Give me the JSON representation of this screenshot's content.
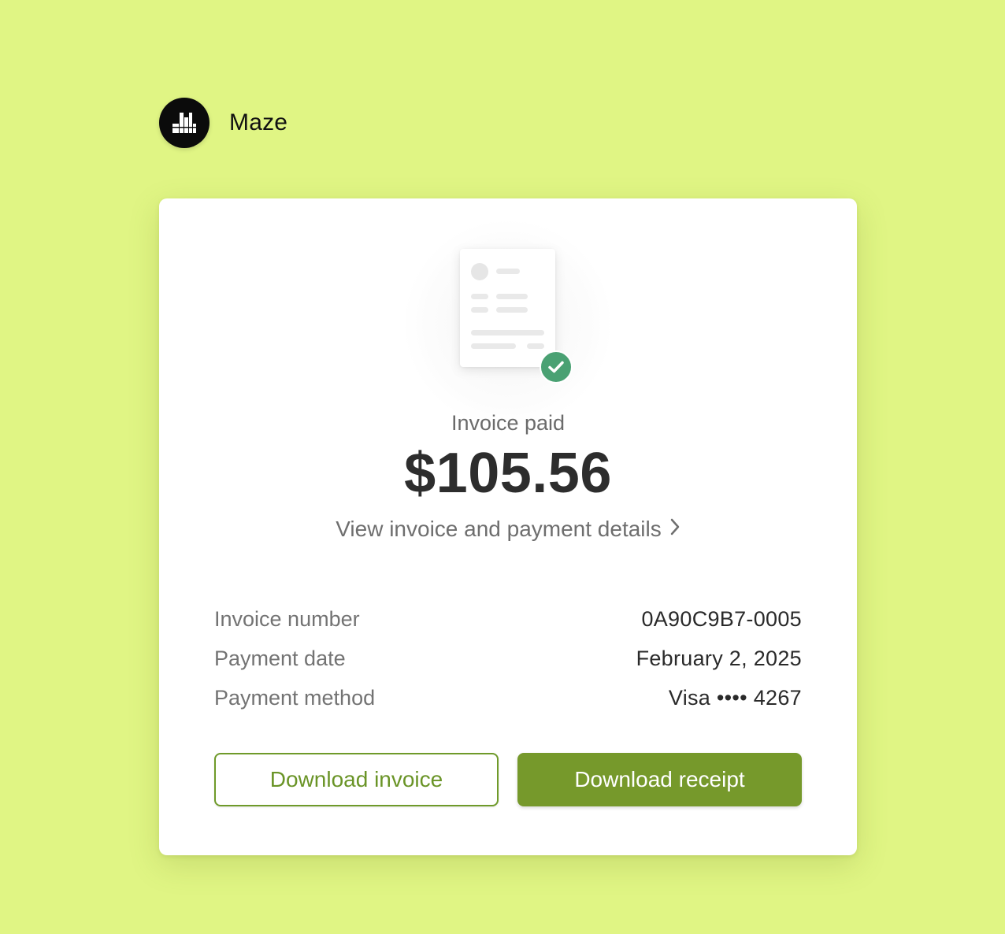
{
  "brand": {
    "name": "Maze",
    "logo_icon": "maze-logo-icon"
  },
  "invoice": {
    "illustration_icon": "invoice-document-icon",
    "status_icon": "checkmark-circle-icon",
    "status_label": "Invoice paid",
    "amount": "$105.56",
    "details_link": "View invoice and payment details",
    "details_link_icon": "chevron-right-icon",
    "rows": [
      {
        "label": "Invoice number",
        "value": "0A90C9B7-0005"
      },
      {
        "label": "Payment date",
        "value": "February 2, 2025"
      },
      {
        "label": "Payment method",
        "value": "Visa •••• 4267"
      }
    ]
  },
  "actions": {
    "download_invoice": "Download invoice",
    "download_receipt": "Download receipt"
  },
  "colors": {
    "background": "#e0f584",
    "accent": "#76992b",
    "success": "#4aa173"
  }
}
